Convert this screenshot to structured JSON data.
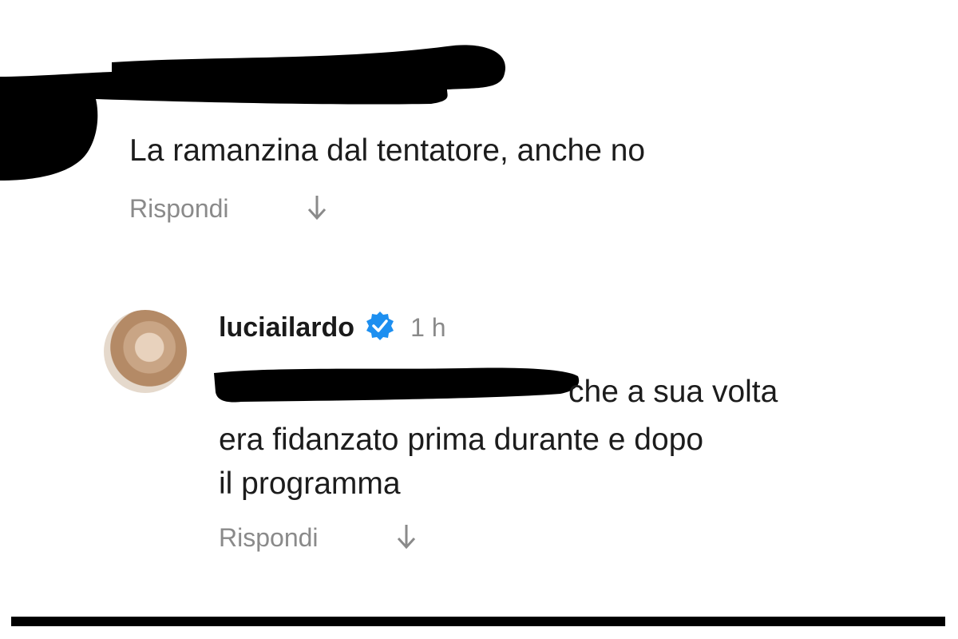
{
  "comment1": {
    "text": "La ramanzina dal tentatore, anche no",
    "reply_label": "Rispondi"
  },
  "comment2": {
    "username": "luciailardo",
    "time": "1 h",
    "line1": "che a sua volta",
    "line2": "era fidanzato prima durante e dopo",
    "line3": "il programma",
    "reply_label": "Rispondi"
  },
  "icons": {
    "verified": "verified-badge-icon",
    "arrow": "arrow-down-icon"
  },
  "colors": {
    "verified_blue": "#1d8ff0",
    "muted_text": "#8a8a8a",
    "redaction": "#000000"
  }
}
